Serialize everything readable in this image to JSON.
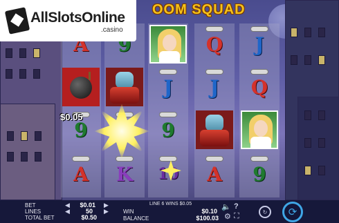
{
  "site_logo": {
    "name": "AllSlotsOnline",
    "sub": ".casino"
  },
  "game_title": "OOM SQUAD",
  "win_popup": "$0.05",
  "reels": [
    [
      {
        "kind": "letter",
        "text": "A",
        "color": "red"
      },
      {
        "kind": "bomb"
      },
      {
        "kind": "letter",
        "text": "9",
        "color": "green"
      },
      {
        "kind": "letter",
        "text": "A",
        "color": "red"
      }
    ],
    [
      {
        "kind": "letter",
        "text": "9",
        "color": "green"
      },
      {
        "kind": "robot"
      },
      {
        "kind": "letter",
        "text": "10",
        "color": "ten"
      },
      {
        "kind": "letter",
        "text": "K",
        "color": "purple"
      }
    ],
    [
      {
        "kind": "portrait"
      },
      {
        "kind": "letter",
        "text": "J",
        "color": "blue"
      },
      {
        "kind": "letter",
        "text": "9",
        "color": "green"
      },
      {
        "kind": "letter",
        "text": "10",
        "color": "ten"
      }
    ],
    [
      {
        "kind": "letter",
        "text": "Q",
        "color": "red"
      },
      {
        "kind": "letter",
        "text": "J",
        "color": "blue"
      },
      {
        "kind": "robot"
      },
      {
        "kind": "letter",
        "text": "A",
        "color": "red"
      }
    ],
    [
      {
        "kind": "letter",
        "text": "J",
        "color": "blue"
      },
      {
        "kind": "letter",
        "text": "Q",
        "color": "red"
      },
      {
        "kind": "portrait"
      },
      {
        "kind": "letter",
        "text": "9",
        "color": "green"
      }
    ]
  ],
  "bottom_bar": {
    "bet_label": "BET",
    "bet_value": "$0.01",
    "lines_label": "LINES",
    "lines_value": "50",
    "total_bet_label": "TOTAL BET",
    "total_bet_value": "$0.50",
    "line_win_text": "LINE 6 WINS $0.05",
    "win_label": "WIN",
    "win_value": "$0.10",
    "balance_label": "BALANCE",
    "balance_value": "$100.03"
  },
  "colors": {
    "accent": "#3fa6e6",
    "bar_bg": "#16183a",
    "title": "#f5c21b"
  }
}
